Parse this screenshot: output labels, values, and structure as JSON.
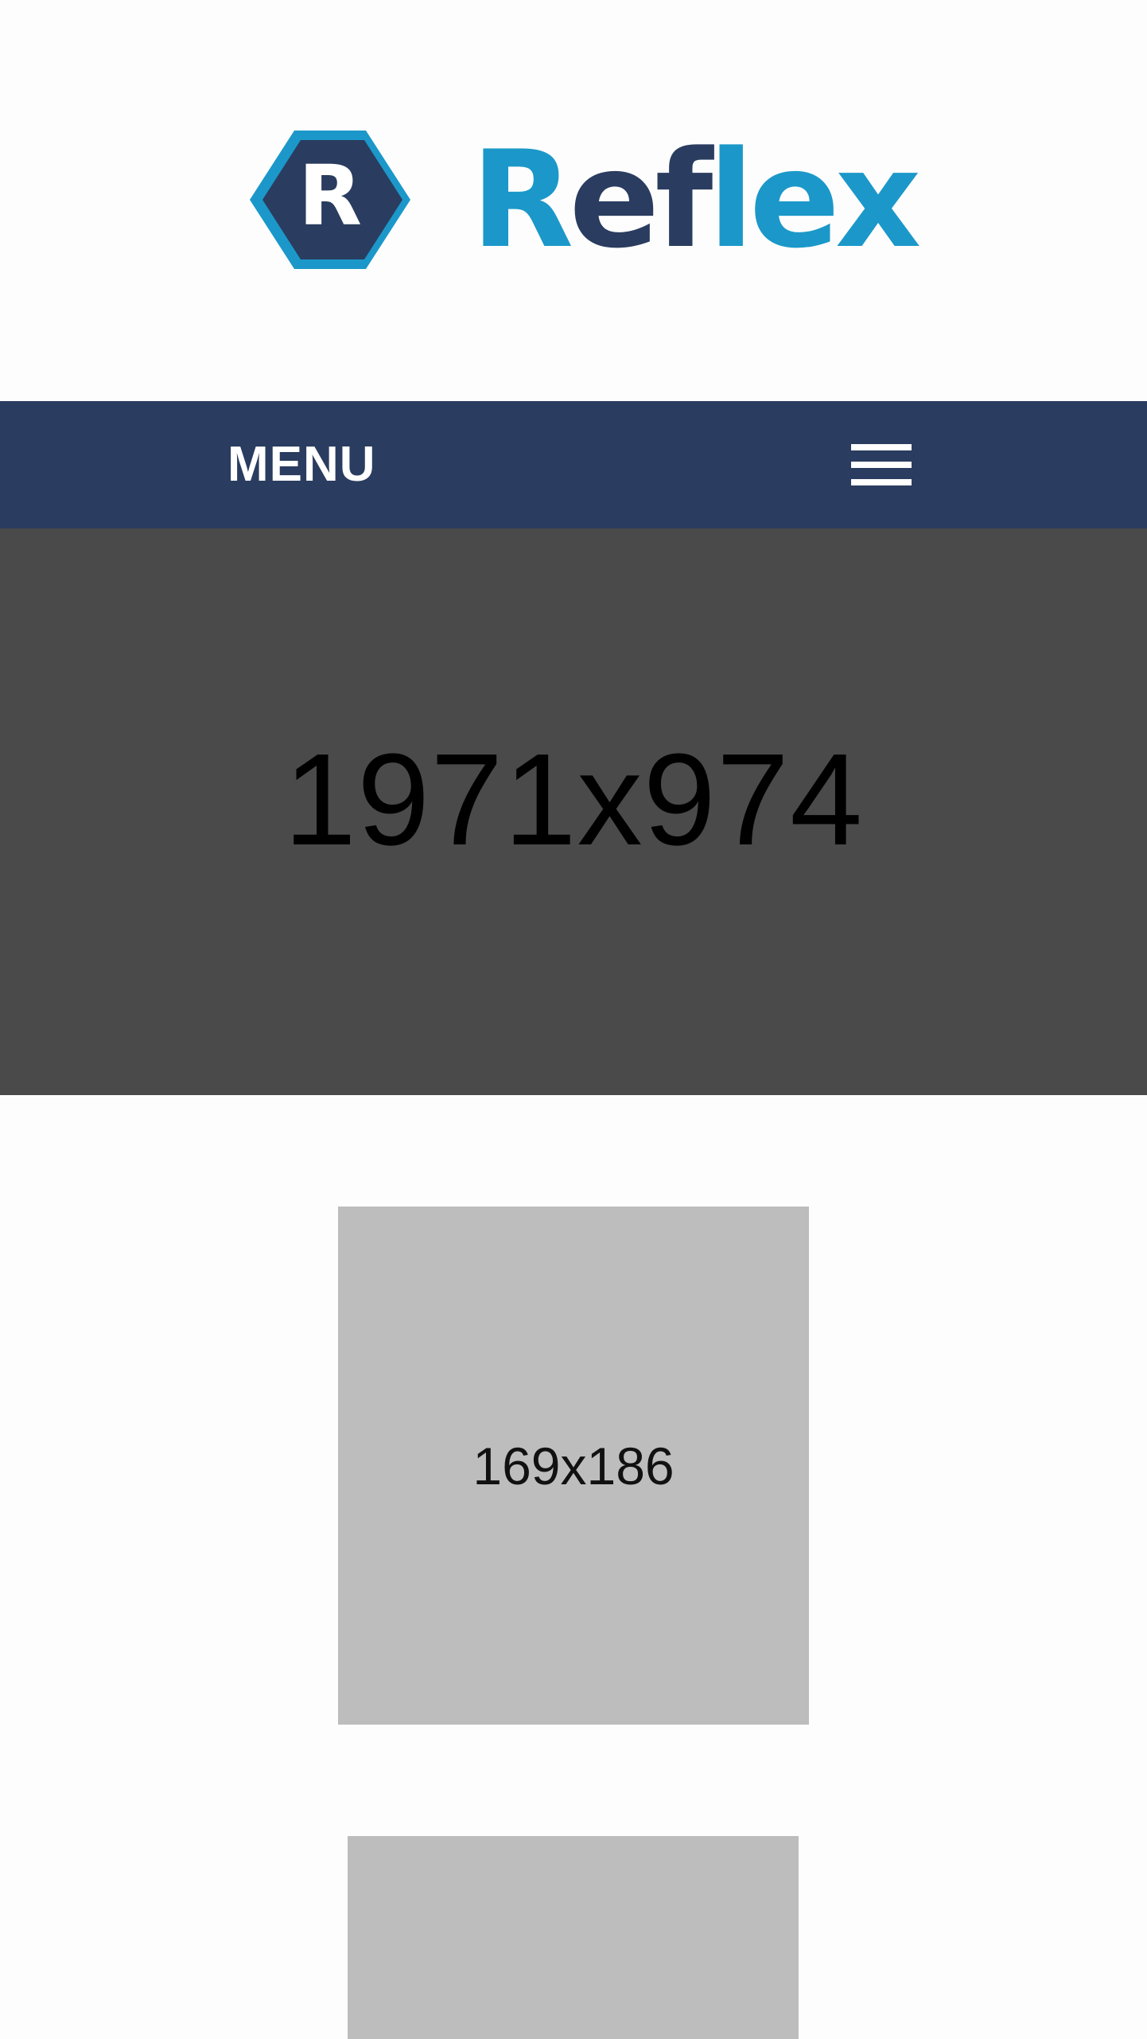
{
  "brand": {
    "name": "Reflex",
    "name_part1": "R",
    "name_part2": "ef",
    "name_part3": "lex",
    "mark_letter": "R"
  },
  "colors": {
    "navy": "#2a3c5f",
    "accent": "#1b98c9",
    "hero_bg": "#4a4a4a",
    "placeholder_bg": "#bdbdbd"
  },
  "nav": {
    "menu_label": "MENU",
    "toggle_icon": "hamburger-icon"
  },
  "hero": {
    "placeholder_text": "1971x974"
  },
  "content": {
    "card1_text": "169x186",
    "card2_text": ""
  }
}
